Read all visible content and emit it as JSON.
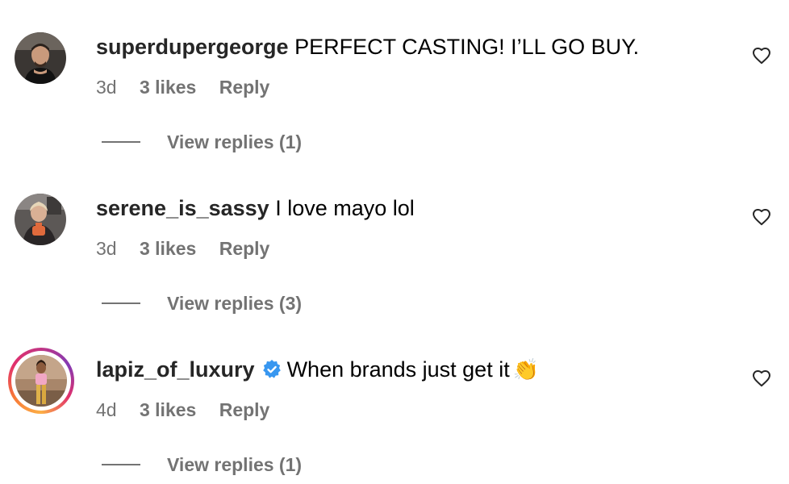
{
  "comments": [
    {
      "username": "superdupergeorge",
      "text": "PERFECT CASTING! I’LL GO BUY.",
      "time": "3d",
      "likes": "3 likes",
      "reply_label": "Reply",
      "view_replies": "View replies (1)",
      "verified": false,
      "has_story": false
    },
    {
      "username": "serene_is_sassy",
      "text": "I love mayo lol",
      "time": "3d",
      "likes": "3 likes",
      "reply_label": "Reply",
      "view_replies": "View replies (3)",
      "verified": false,
      "has_story": false
    },
    {
      "username": "lapiz_of_luxury",
      "text": "When brands just get it",
      "emoji": "👏",
      "time": "4d",
      "likes": "3 likes",
      "reply_label": "Reply",
      "view_replies": "View replies (1)",
      "verified": true,
      "has_story": true
    }
  ],
  "icons": {
    "like": "heart-outline-icon",
    "verified": "verified-badge-icon"
  },
  "colors": {
    "secondary_text": "#737373",
    "verified_blue": "#3897f0"
  }
}
